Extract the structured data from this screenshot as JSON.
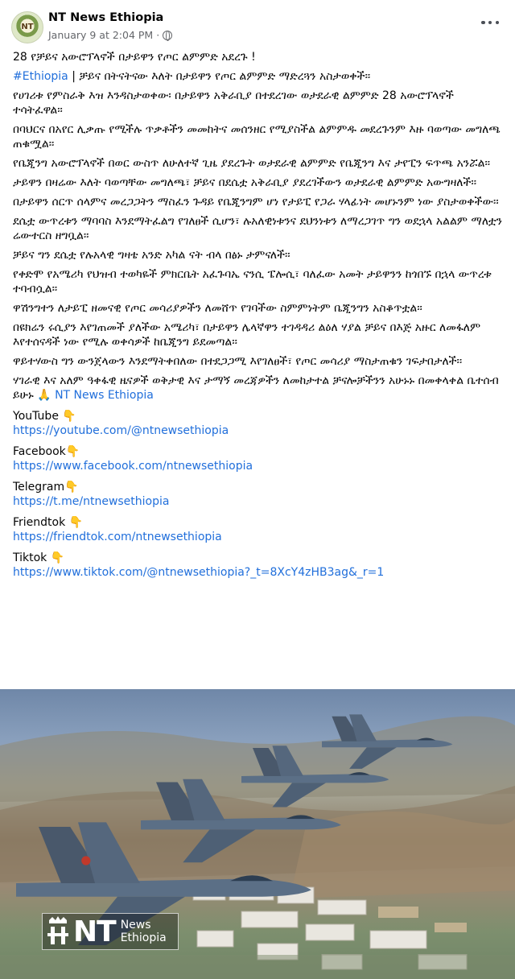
{
  "header": {
    "avatar_text": "NT",
    "page_name": "NT News Ethiopia",
    "timestamp": "January 9 at 2:04 PM",
    "separator": "·",
    "privacy_icon": "globe-icon",
    "more_icon": "more-horizontal-icon"
  },
  "post": {
    "headline": "28 የቻይና አውሮፕላኖች በታይዋን የጦር ልምምድ አደረጉ !",
    "hashtag": "#Ethiopia",
    "intro_rest": " | ቻይና በትናትናው እለት በታይዋን የጦር ልምምድ ማድረጓን አስታወቀች፡፡",
    "paragraphs": [
      "የሀገሪቱ የምስራቅ እዝ እንዳስታወቀው፡ በታይዋን አቅራቢያ በተደረገው ወታደራዊ ልምምድ 28 አውሮፕላኖች ተሳትፈዋል፡፡",
      "በባህርና በአየር ሊቃጡ የሚችሉ ጥቃቶችን መመከትና መሰንዘር የሚያስችል ልምምዱ መደረጉንም እዙ ባወጣው መግለጫ ጠቁሟል፡፡",
      "የቤጂንግ አውሮፕላኖች በወር ውስጥ ለሁለተኛ ጊዜ ያደረጉት ወታደራዊ ልምምድ የቤጂንግ እና ታየፒን ፍጥጫ አንሯል፡፡",
      "ታይዋን በዛሬው እለት ባወጣቸው መግለጫ፣ ቻይና በደሴቷ አቅራቢያ ያደረገችውን ወታደራዊ ልምምድ አውግዛለች፡፡",
      "በታይዋን ሰርጥ ሰላምና መረጋጋትን ማስፈን ጉዳይ የቤጂንግም ሆነ የታይፒ የጋራ ሃላፊነት መሆኑንም ነው ያስታወቀችው፡፡",
      "ደሴቷ ውጥረቱን ማባባስ እንደማትፈልግ የገለፀች ሲሆን፣ ሉአለዊነቱንና ደህንነቱን ለማረጋገጥ ግን ወደኋላ አልልም ማለቷን ሬውተርስ ዘግቧል፡፡",
      "ቻይና ግን ደሴቷ የሉአላዊ ግዛቴ አንድ አካል ናት ብላ በፅኑ ታምናለች፡፡",
      "የቀድሞ የአሜሪካ የህዝብ ተወካዬች ምክርቤት አፈጉባኤ ናንሲ ፔሎሲ፣ ባለፈው አመት ታይዋንን ከጎበኙ በኋላ ውጥረቱ ተባብሷል፡፡",
      "ዋሽንግተን ለታይፒ ዘመናዊ የጦር መሳሪያዎችን ለመሸጥ የገባችው ስምምነትም ቤጂንግን አስቆጥቷል፡፡",
      "በዩክሬን ሩሲያን እየገጠመች ያለችው አሜሪካ፣ በታይዋን ሌላኛዋን ተገዳዳሪ ልዕለ ሃያል ቻይና በእጅ አዙር ለመፋለም እየተሰናዳች ነው የሚሉ ወቀሳዎች ከቤጂንግ ይደመጣል፡፡",
      "ዋይተሃውስ ግን ውንጀላውን እንደማትቀበለው በተደጋጋሚ እየገለፀች፣ የጦር መሳሪያ ማስታጠቁን ገፍታበታለች፡፡"
    ],
    "closing": "ሃገራዊ እና አለም ዓቀፋዊ  ዜናዎች ወቅታዊ እና ታማኝ መረጃዎችን  ለመከታተል ቻናሎቻችንን አሁኑኑ በመቀላቀል ቤተሰብ ይሁኑ 🙏",
    "closing_link": "NT News Ethiopia",
    "socials": [
      {
        "label": "YouTube 👇",
        "url": "https://youtube.com/@ntnewsethiopia"
      },
      {
        "label": "Facebook👇",
        "url": "https://www.facebook.com/ntnewsethiopia"
      },
      {
        "label": "Telegram👇",
        "url": "https://t.me/ntnewsethiopia"
      },
      {
        "label": "Friendtok 👇",
        "url": "https://friendtok.com/ntnewsethiopia"
      },
      {
        "label": "Tiktok 👇",
        "url": "https://www.tiktok.com/@ntnewsethiopia?_t=8XcY4zHB3ag&_r=1"
      }
    ]
  },
  "photo": {
    "subject": "fighter-jets-in-formation",
    "watermark_mark": "NT",
    "watermark_line1": "News",
    "watermark_line2": "Ethiopia"
  },
  "colors": {
    "link": "#216fdb",
    "secondary_text": "#65676b",
    "jet_body": "#5b6f86"
  }
}
